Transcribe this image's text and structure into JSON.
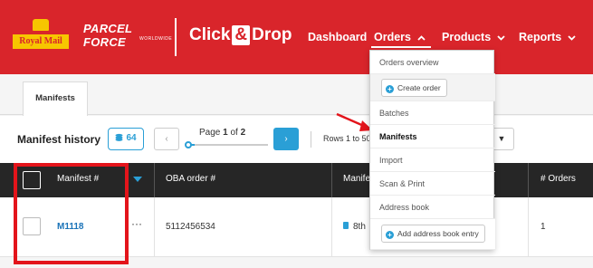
{
  "header": {
    "royal_mail_logo": "Royal Mail",
    "parcelforce_logo": "PARCEL FORCE",
    "parcelforce_sub": "WORLDWIDE",
    "app_logo_left": "Click",
    "app_logo_amp": "&",
    "app_logo_right": "Drop",
    "nav": {
      "dashboard": "Dashboard",
      "orders": "Orders",
      "products": "Products",
      "reports": "Reports"
    },
    "caret_up": "⌃",
    "caret_down": "⌄"
  },
  "tabs": [
    {
      "label": "Manifests"
    }
  ],
  "history": {
    "title": "Manifest history",
    "count_badge": "64",
    "page_label_prefix": "Page ",
    "page_current": "1",
    "page_label_mid": " of ",
    "page_total": "2",
    "progress": 0.1,
    "rows_label": "Rows 1 to 50",
    "prev_icon": "‹",
    "next_icon": "›",
    "dropdown_icon": "▼"
  },
  "table": {
    "columns": [
      "Manifest #",
      "OBA order #",
      "Manifest",
      "# Orders"
    ],
    "rows": [
      {
        "manifest": "M1118",
        "actions": "···",
        "oba_order": "5112456534",
        "date": "8th",
        "orders": "1"
      }
    ]
  },
  "orders_menu": {
    "items": [
      {
        "label": "Orders overview"
      },
      {
        "label": "Create order",
        "type": "button"
      },
      {
        "label": "Batches"
      },
      {
        "label": "Manifests",
        "active": true
      },
      {
        "label": "Import"
      },
      {
        "label": "Scan & Print"
      },
      {
        "label": "Address book"
      },
      {
        "label": "Add address book entry",
        "type": "button"
      }
    ],
    "plus_icon": "+"
  },
  "colors": {
    "brand_red": "#d9252b",
    "accent_blue": "#2a9fd6",
    "highlight_red": "#e3141b",
    "header_dark": "#262626"
  }
}
